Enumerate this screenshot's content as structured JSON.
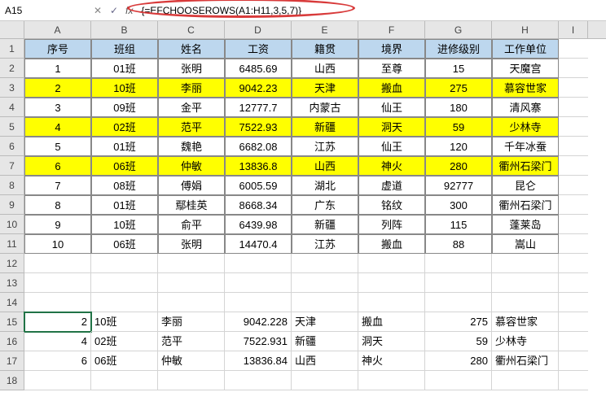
{
  "name_box": {
    "value": "A15"
  },
  "formula": "{=EFCHOOSEROWS(A1:H11,3,5,7)}",
  "fx_label": "fx",
  "cancel_glyph": "✕",
  "confirm_glyph": "✓",
  "dropdown_glyph": "▾",
  "columns": [
    "A",
    "B",
    "C",
    "D",
    "E",
    "F",
    "G",
    "H",
    "I"
  ],
  "row_headers": [
    "1",
    "2",
    "3",
    "4",
    "5",
    "6",
    "7",
    "8",
    "9",
    "10",
    "11",
    "12",
    "13",
    "14",
    "15",
    "16",
    "17",
    "18"
  ],
  "header_row": [
    "序号",
    "班组",
    "姓名",
    "工资",
    "籍贯",
    "境界",
    "进修级别",
    "工作单位"
  ],
  "data_rows": [
    {
      "vals": [
        "1",
        "01班",
        "张明",
        "6485.69",
        "山西",
        "至尊",
        "15",
        "天魔宫"
      ],
      "hi": false
    },
    {
      "vals": [
        "2",
        "10班",
        "李丽",
        "9042.23",
        "天津",
        "搬血",
        "275",
        "慕容世家"
      ],
      "hi": true
    },
    {
      "vals": [
        "3",
        "09班",
        "金平",
        "12777.7",
        "内蒙古",
        "仙王",
        "180",
        "清风寨"
      ],
      "hi": false
    },
    {
      "vals": [
        "4",
        "02班",
        "范平",
        "7522.93",
        "新疆",
        "洞天",
        "59",
        "少林寺"
      ],
      "hi": true
    },
    {
      "vals": [
        "5",
        "01班",
        "魏艳",
        "6682.08",
        "江苏",
        "仙王",
        "120",
        "千年冰蚕"
      ],
      "hi": false
    },
    {
      "vals": [
        "6",
        "06班",
        "仲敏",
        "13836.8",
        "山西",
        "神火",
        "280",
        "衢州石梁门"
      ],
      "hi": true
    },
    {
      "vals": [
        "7",
        "08班",
        "傅娟",
        "6005.59",
        "湖北",
        "虚道",
        "92777",
        "昆仑"
      ],
      "hi": false
    },
    {
      "vals": [
        "8",
        "01班",
        "鄢桂英",
        "8668.34",
        "广东",
        "铭纹",
        "300",
        "衢州石梁门"
      ],
      "hi": false
    },
    {
      "vals": [
        "9",
        "10班",
        "俞平",
        "6439.98",
        "新疆",
        "列阵",
        "115",
        "蓬莱岛"
      ],
      "hi": false
    },
    {
      "vals": [
        "10",
        "06班",
        "张明",
        "14470.4",
        "江苏",
        "搬血",
        "88",
        "嵩山"
      ],
      "hi": false
    }
  ],
  "result_rows": [
    [
      "2",
      "10班",
      "李丽",
      "9042.228",
      "天津",
      "搬血",
      "275",
      "慕容世家"
    ],
    [
      "4",
      "02班",
      "范平",
      "7522.931",
      "新疆",
      "洞天",
      "59",
      "少林寺"
    ],
    [
      "6",
      "06班",
      "仲敏",
      "13836.84",
      "山西",
      "神火",
      "280",
      "衢州石梁门"
    ]
  ]
}
